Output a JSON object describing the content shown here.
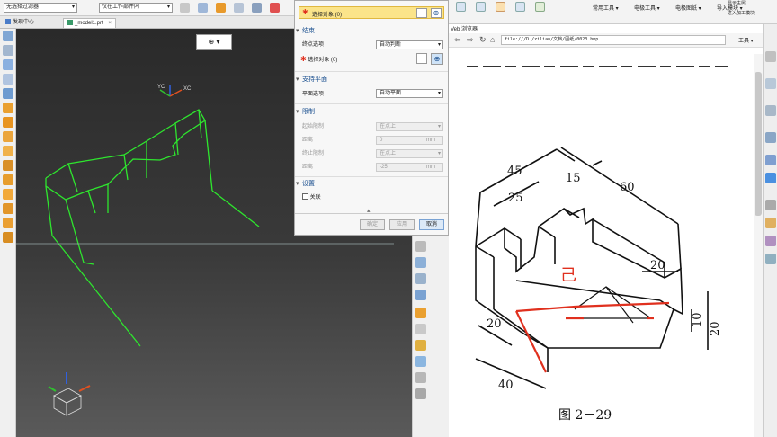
{
  "toolbar": {
    "filter_dropdown": "无选择过滤器",
    "scope_dropdown": "仅在工作部件内"
  },
  "tabs": [
    {
      "label": "发现中心"
    },
    {
      "label": "_model1.prt"
    }
  ],
  "viewport": {
    "snap_button_label": "⊕ ▾",
    "axis_labels": {
      "yc": "YC",
      "xc": "XC"
    }
  },
  "dialog": {
    "top_select_label": "选择对象 (0)",
    "sections": {
      "end": "结束",
      "support": "支持平面",
      "limits": "限制",
      "settings": "设置"
    },
    "end_option_label": "终点选项",
    "end_option_value": "自动判断",
    "end_select_label": "选择对象 (0)",
    "plane_option_label": "平面选项",
    "plane_option_value": "自动平面",
    "start_limit_label": "起始限制",
    "start_limit_value": "在点上",
    "distance1_label": "距离",
    "distance1_value": "0",
    "distance1_unit": "mm",
    "end_limit_label": "终止限制",
    "end_limit_value": "在点上",
    "distance2_label": "距离",
    "distance2_value": "-25",
    "distance2_unit": "mm",
    "associative_label": "关联",
    "ok_button": "确定",
    "apply_button": "应用",
    "cancel_button": "取消"
  },
  "right_toolbar": {
    "common_tools": "常用工具 ▾",
    "electrode_tools": "电极工具 ▾",
    "electrode_drawing": "电极图纸 ▾",
    "import_module": "导入模块 ▾",
    "line1": "显示主属",
    "line2": "进入加工模块"
  },
  "browser": {
    "title": "Veb 浏览器",
    "url": "file:///D /zilian/文档/图纸/0023.bmp",
    "tools_menu": "工具 ▾"
  },
  "drawing": {
    "dims": {
      "d45": "45",
      "d15": "15",
      "d60": "60",
      "d25": "25",
      "d20a": "20",
      "d20b": "20",
      "d20c": "20",
      "d10": "10",
      "d40": "40"
    },
    "caption": "图   2－29",
    "handwritten": "己"
  },
  "colors": {
    "viewport_bg": "#2f2f2f",
    "wire": "#2ee62e",
    "dialog_highlight": "#fbe48a",
    "accent_blue": "#1a4f8f",
    "red_mark": "#e0301e"
  }
}
